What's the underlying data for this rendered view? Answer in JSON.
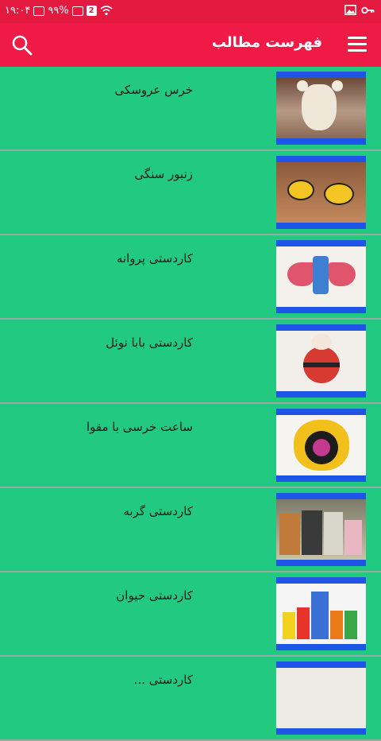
{
  "status_bar": {
    "time": "۱۹:۰۴",
    "battery": "۹۹%",
    "notification_count": "2",
    "icons": [
      "key-icon",
      "image-icon",
      "wifi-icon",
      "signal-icon",
      "battery-icon"
    ]
  },
  "app_bar": {
    "title": "فهرست مطالب",
    "icons": [
      "search-icon",
      "menu-icon"
    ],
    "color": "#f01a46"
  },
  "list": {
    "items": [
      {
        "title": "خرس عروسکی"
      },
      {
        "title": "زنبور سنگی"
      },
      {
        "title": "کاردستی پروانه"
      },
      {
        "title": "کاردستی بابا نوئل"
      },
      {
        "title": "ساعت خرسی با مقوا"
      },
      {
        "title": "کاردستی گربه"
      },
      {
        "title": "کاردستی حیوان"
      },
      {
        "title": "کاردستی ..."
      }
    ],
    "background": "#22c980",
    "thumb_border": "#1e55e6"
  }
}
